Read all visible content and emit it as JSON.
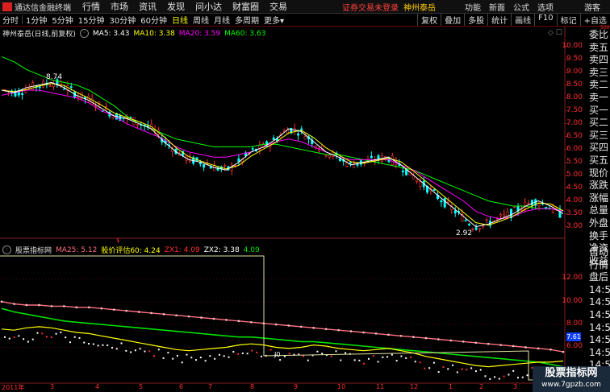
{
  "menubar": {
    "app_name": "通达信金融终端",
    "items": [
      "行情",
      "市场",
      "资讯",
      "发现",
      "问小达",
      "财富圈",
      "交易"
    ],
    "promo": "证券交易未登录",
    "promo2": "神州泰岳",
    "right_items": [
      "功能",
      "新面",
      "公式",
      "选项"
    ],
    "guest": "游客"
  },
  "toolbar": {
    "periods": [
      "分时",
      "1分钟",
      "5分钟",
      "15分钟",
      "30分钟",
      "60分钟",
      "日线",
      "周线",
      "月线",
      "多周期",
      "更多"
    ],
    "active_index": 6,
    "buttons": [
      "复权",
      "叠加",
      "多股",
      "统计",
      "画线",
      "F10",
      "标记",
      "+自选"
    ]
  },
  "main_legend": {
    "stock": "神州泰岳(日线,前复权)",
    "ma5": "MA5: 3.43",
    "ma10": "MA10: 3.38",
    "ma20": "MA20: 3.59",
    "ma60": "MA60: 3.63"
  },
  "main_axis": [
    "10.00",
    "9.50",
    "9.00",
    "8.50",
    "8.00",
    "7.50",
    "7.00",
    "6.50",
    "6.00",
    "5.50",
    "5.00",
    "4.50",
    "4.00",
    "3.50",
    "3.00"
  ],
  "annotations": {
    "high": "8.74",
    "low": "2.92"
  },
  "sub_legend": {
    "name": "股票指标网",
    "ma25": "MA25: 5.12",
    "pj": "股价评估60: 4.24",
    "zx1": "ZX1: 4.09",
    "zx2": "ZX2: 3.38",
    "zxv": "4.09"
  },
  "sub_axis": [
    "12.00",
    "10.00",
    "8.00",
    "6.00"
  ],
  "sub_badge": "7.61",
  "side_top": [
    "委比",
    "卖五",
    "卖四",
    "卖三",
    "卖二",
    "卖一",
    "买一",
    "买二",
    "买三",
    "买四",
    "买五",
    "现价",
    "涨跌",
    "涨幅",
    "总量",
    "外盘",
    "换手",
    "净资",
    "收益"
  ],
  "side_bottom": [
    "自动",
    "行情",
    "盘后",
    "14:5",
    "14:5",
    "14:5",
    "14:5",
    "14:5",
    "14:5",
    "14:5",
    "14:5",
    "14:5"
  ],
  "corner_text": "500",
  "xaxis": {
    "year": "2011年",
    "months": [
      "3",
      "4",
      "5",
      "6",
      "7",
      "8",
      "9",
      "10",
      "11",
      "12",
      "1",
      "2",
      "3"
    ]
  },
  "watermark": {
    "title": "股票指标网",
    "url": "www.7gpzb.com"
  },
  "colors": {
    "ma5": "#ffffff",
    "ma10": "#ffff00",
    "ma20": "#ff00ff",
    "ma60": "#00ff00",
    "up": "#ff3030",
    "down": "#00ffff",
    "pink": "#ff7080",
    "green": "#00e000",
    "yellow": "#ffff00"
  },
  "chart_data": [
    {
      "type": "line",
      "title": "神州泰岳(日线,前复权)",
      "ylim": [
        2.8,
        10.3
      ],
      "series": [
        {
          "name": "MA5",
          "values": [
            8.3,
            8.2,
            8.4,
            8.5,
            8.6,
            8.4,
            8.1,
            7.9,
            7.6,
            7.3,
            7.2,
            7.0,
            6.8,
            6.3,
            5.9,
            5.6,
            5.5,
            5.3,
            5.2,
            5.5,
            5.9,
            6.1,
            6.4,
            6.8,
            6.7,
            6.3,
            5.9,
            5.7,
            5.4,
            5.5,
            5.6,
            5.7,
            5.4,
            5.0,
            4.6,
            4.2,
            3.8,
            3.4,
            3.0,
            3.1,
            3.3,
            3.5,
            3.8,
            4.0,
            3.8,
            3.5
          ]
        },
        {
          "name": "MA60",
          "values": [
            9.6,
            9.4,
            9.1,
            8.9,
            8.7,
            8.6,
            8.5,
            8.3,
            8.0,
            7.7,
            7.3,
            7.0,
            6.8,
            6.6,
            6.4,
            6.3,
            6.2,
            6.1,
            6.1,
            6.1,
            6.1,
            6.2,
            6.2,
            6.1,
            6.0,
            5.9,
            5.8,
            5.8,
            5.7,
            5.6,
            5.5,
            5.4,
            5.3,
            5.2,
            5.0,
            4.8,
            4.6,
            4.4,
            4.2,
            4.0,
            3.9,
            3.8,
            3.8,
            3.7,
            3.7,
            3.6
          ]
        },
        {
          "name": "MA20",
          "values": [
            8.1,
            8.2,
            8.3,
            8.3,
            8.2,
            8.1,
            8.0,
            7.8,
            7.5,
            7.3,
            7.0,
            6.8,
            6.6,
            6.4,
            6.1,
            5.9,
            5.8,
            5.7,
            5.7,
            5.8,
            5.9,
            6.1,
            6.3,
            6.4,
            6.3,
            6.1,
            5.9,
            5.7,
            5.6,
            5.6,
            5.6,
            5.6,
            5.4,
            5.2,
            4.9,
            4.6,
            4.3,
            4.0,
            3.6,
            3.4,
            3.3,
            3.4,
            3.6,
            3.7,
            3.7,
            3.6
          ]
        }
      ]
    },
    {
      "type": "line",
      "title": "股票指标网",
      "ylim": [
        3.0,
        14.0
      ],
      "series": [
        {
          "name": "MA25",
          "values": [
            10.0,
            9.8,
            9.7,
            9.7,
            9.6,
            9.6,
            9.5,
            9.5,
            9.4,
            9.3,
            9.2,
            9.1,
            9.0,
            8.9,
            8.8,
            8.7,
            8.6,
            8.5,
            8.4,
            8.3,
            8.2,
            8.1,
            8.0,
            7.9,
            7.8,
            7.7,
            7.6,
            7.5,
            7.4,
            7.3,
            7.2,
            7.1,
            7.0,
            6.9,
            6.8,
            6.7,
            6.6,
            6.5,
            6.4,
            6.3,
            6.2,
            6.1,
            6.0,
            5.9,
            5.8,
            5.6
          ]
        },
        {
          "name": "ZX2",
          "values": [
            9.4,
            9.1,
            8.9,
            8.7,
            8.5,
            8.3,
            8.2,
            8.1,
            8.0,
            7.9,
            7.8,
            7.7,
            7.6,
            7.5,
            7.4,
            7.3,
            7.2,
            7.1,
            7.0,
            6.9,
            6.9,
            6.8,
            6.7,
            6.6,
            6.5,
            6.5,
            6.4,
            6.3,
            6.2,
            6.1,
            6.0,
            5.9,
            5.8,
            5.7,
            5.6,
            5.5,
            5.4,
            5.3,
            5.2,
            5.1,
            5.0,
            4.9,
            4.8,
            4.7,
            4.5,
            4.3
          ]
        },
        {
          "name": "股价评估60",
          "values": [
            7.6,
            7.5,
            7.7,
            7.8,
            7.7,
            7.5,
            7.3,
            7.2,
            7.0,
            6.8,
            6.6,
            6.4,
            6.2,
            6.0,
            5.8,
            5.7,
            5.8,
            5.9,
            6.0,
            6.2,
            6.3,
            6.2,
            6.0,
            5.9,
            6.0,
            6.2,
            6.1,
            5.9,
            5.8,
            5.7,
            5.8,
            5.9,
            5.7,
            5.5,
            5.2,
            5.0,
            4.8,
            4.6,
            4.4,
            4.3,
            4.4,
            4.5,
            4.6,
            4.7,
            4.7,
            4.8
          ]
        }
      ]
    }
  ]
}
